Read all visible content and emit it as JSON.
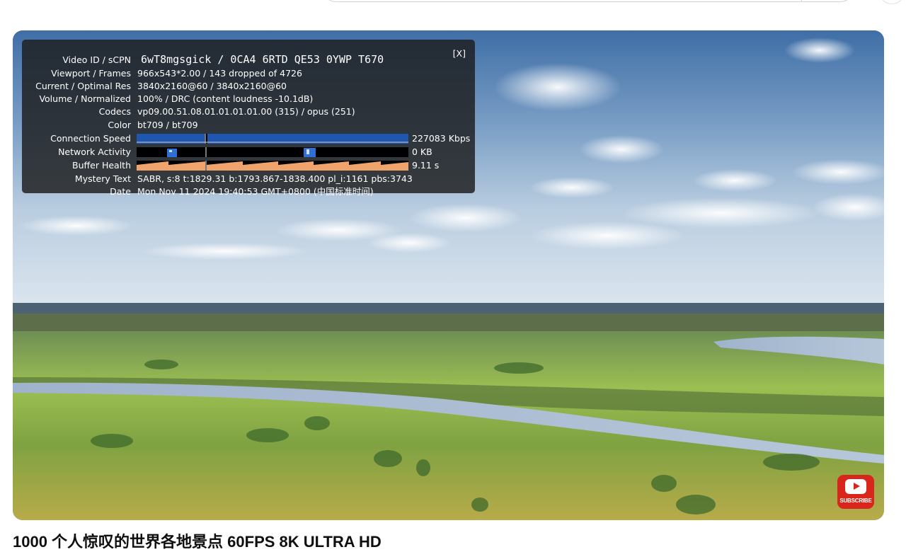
{
  "stats_panel": {
    "close_label": "[X]",
    "rows": {
      "video_id": {
        "label": "Video ID / sCPN",
        "value": "6wT8mgsgick / 0CA4 6RTD QE53 0YWP T670"
      },
      "viewport": {
        "label": "Viewport / Frames",
        "value": "966x543*2.00 / 143 dropped of 4726"
      },
      "resolution": {
        "label": "Current / Optimal Res",
        "value": "3840x2160@60 / 3840x2160@60"
      },
      "volume": {
        "label": "Volume / Normalized",
        "value": "100% / DRC (content loudness -10.1dB)"
      },
      "codecs": {
        "label": "Codecs",
        "value": "vp09.00.51.08.01.01.01.01.00 (315) / opus (251)"
      },
      "color": {
        "label": "Color",
        "value": "bt709 / bt709"
      },
      "connection": {
        "label": "Connection Speed",
        "value": "227083 Kbps"
      },
      "network": {
        "label": "Network Activity",
        "value": "0 KB"
      },
      "buffer": {
        "label": "Buffer Health",
        "value": "9.11 s"
      },
      "mystery": {
        "label": "Mystery Text",
        "value": "SABR, s:8 t:1829.31 b:1793.867-1838.400 pl_i:1161 pbs:3743"
      },
      "date": {
        "label": "Date",
        "value": "Mon Nov 11 2024 19:40:53 GMT+0800 (中国标准时间)"
      }
    },
    "colors": {
      "connection_bar": "#1f56b0",
      "buffer_fill": "#f0a36b",
      "network_fill": "#2f6fd6"
    }
  },
  "subscribe_badge": {
    "label": "SUBSCRIBE",
    "icon": "youtube-play-icon"
  },
  "video_title": "1000 个人惊叹的世界各地景点 60FPS 8K ULTRA HD"
}
